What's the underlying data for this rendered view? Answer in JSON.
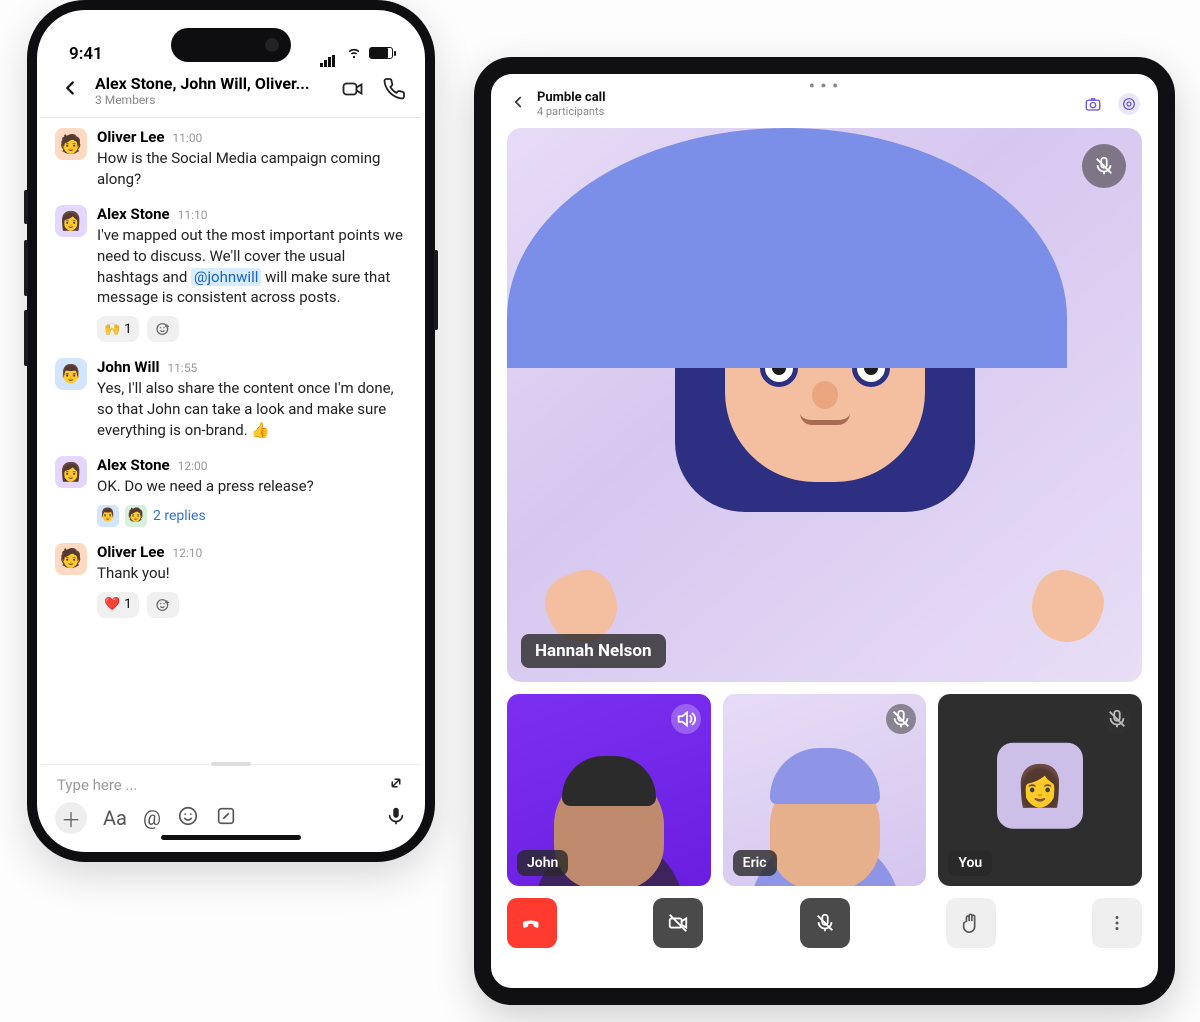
{
  "phone": {
    "status": {
      "time": "9:41"
    },
    "header": {
      "title": "Alex Stone, John Will, Oliver...",
      "subtitle": "3 Members"
    },
    "messages": [
      {
        "author": "Oliver Lee",
        "time": "11:00",
        "text": "How is the Social Media campaign coming along?"
      },
      {
        "author": "Alex Stone",
        "time": "11:10",
        "text_before": "I've mapped out the most important points we need to discuss. We'll cover the usual hashtags and ",
        "mention": "@johnwill",
        "text_after": " will make sure that message is consistent across posts.",
        "reaction_emoji": "🙌",
        "reaction_count": "1"
      },
      {
        "author": "John Will",
        "time": "11:55",
        "text": "Yes, I'll also share the content once I'm done, so that John can take a look and make sure everything is on-brand. 👍"
      },
      {
        "author": "Alex Stone",
        "time": "12:00",
        "text": "OK. Do we need a press release?",
        "replies_label": "2 replies"
      },
      {
        "author": "Oliver Lee",
        "time": "12:10",
        "text": "Thank you!",
        "reaction_emoji": "❤️",
        "reaction_count": "1"
      }
    ],
    "composer": {
      "placeholder": "Type here ...",
      "format_label": "Aa",
      "mention_label": "@"
    }
  },
  "tablet": {
    "header": {
      "title": "Pumble call",
      "subtitle": "4 participants"
    },
    "main_speaker": "Hannah Nelson",
    "tiles": [
      {
        "name": "John"
      },
      {
        "name": "Eric"
      },
      {
        "name": "You"
      }
    ]
  }
}
